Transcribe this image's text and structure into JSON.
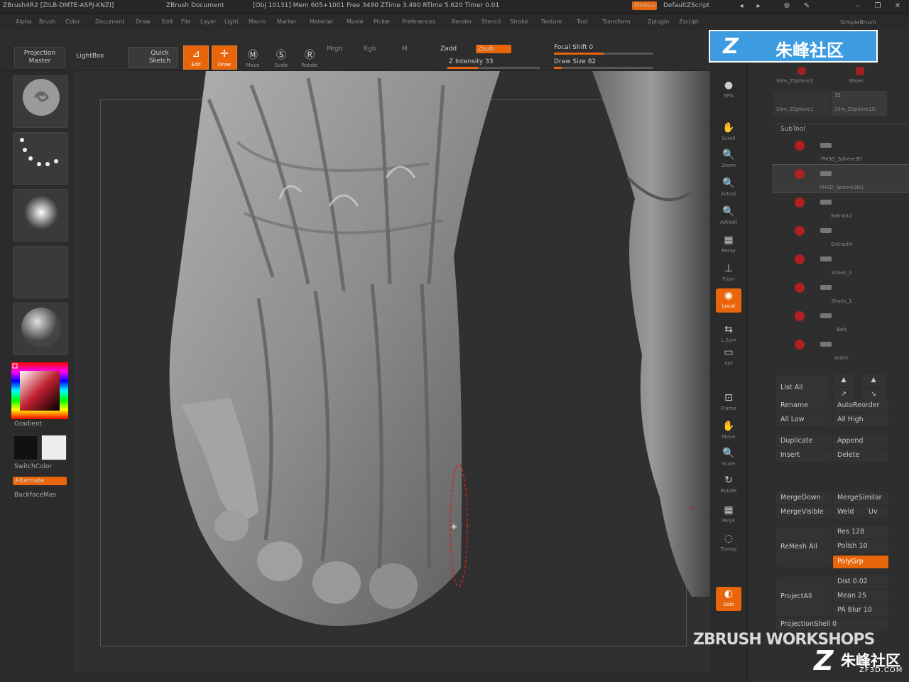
{
  "titlebar": {
    "app": "ZBrush4R2 [ZILB-DMTE-ASPJ-KNZI]",
    "doc": "ZBrush Document",
    "stats": "[Obj 10131]  Mem 605+1001  Free 3490  ZTime 3.490  RTime 5.620  Timer 0.01",
    "menus_label": "Menus",
    "script_label": "DefaultZScript"
  },
  "menubar": {
    "items": [
      "Alpha",
      "Brush",
      "Color",
      "Document",
      "Draw",
      "Edit",
      "File",
      "Layer",
      "Light",
      "Macro",
      "Marker",
      "Material",
      "Movie",
      "Picker",
      "Preferences",
      "Render",
      "Stencil",
      "Stroke",
      "Texture",
      "Tool",
      "Transform",
      "Zplugin",
      "Zscript"
    ]
  },
  "toolbar": {
    "projection_master": "Projection Master",
    "lightbox": "LightBox",
    "quick_sketch": "Quick Sketch",
    "edit": "Edit",
    "draw": "Draw",
    "move": "Move",
    "scale": "Scale",
    "rotate": "Rotate",
    "mrgb": "Mrgb",
    "rgb": "Rgb",
    "m": "M",
    "zadd": "Zadd",
    "zsub": "Zsub",
    "z_intensity_label": "Z Intensity 33",
    "z_intensity": 33,
    "focal_shift_label": "Focal Shift 0",
    "focal_shift": 0,
    "draw_size_label": "Draw Size 82",
    "draw_size": 82
  },
  "left": {
    "gradient_label": "Gradient",
    "switchcolor_label": "SwitchColor",
    "alternate_label": "Alternate",
    "backfacemask_label": "BackfaceMas"
  },
  "shelf": [
    {
      "label": "SPix"
    },
    {
      "label": "Scroll"
    },
    {
      "label": "Zoom"
    },
    {
      "label": "Actual"
    },
    {
      "label": "AAHalf"
    },
    {
      "label": "Persp"
    },
    {
      "label": "Floor"
    },
    {
      "label": "Local"
    },
    {
      "label": "L.Sym"
    },
    {
      "label": "xyz"
    },
    {
      "label": "Frame"
    },
    {
      "label": "Move"
    },
    {
      "label": "Scale"
    },
    {
      "label": "Rotate"
    },
    {
      "label": "PolyF"
    },
    {
      "label": "Transp"
    },
    {
      "label": "Solo"
    }
  ],
  "tray": {
    "simplebrush": "SimpleBrush",
    "tool_thumbs": [
      "Slim_ZSphere2",
      "Shoes",
      "Slim_ZSphere1",
      "Slim_ZSphere1G"
    ],
    "tool_count": "11",
    "subtool_header": "SubTool",
    "subtools": [
      "PM3D_Sphere3D",
      "PM3D_Sphere3D1",
      "Extract2",
      "Extract4",
      "Shoes_2",
      "Shoes_1",
      "Belt",
      "Ankle"
    ],
    "list_all": "List All",
    "rename": "Rename",
    "autoreorder": "AutoReorder",
    "all_low": "All Low",
    "all_high": "All High",
    "duplicate": "Duplicate",
    "append": "Append",
    "insert": "Insert",
    "delete": "Delete",
    "mergedown": "MergeDown",
    "mergesimilar": "MergeSimilar",
    "mergevisible": "MergeVisible",
    "weld": "Weld",
    "uv": "Uv",
    "remesh_all": "ReMesh All",
    "res": "Res 128",
    "polish": "Polish 10",
    "polygrp": "PolyGrp",
    "project_all": "ProjectAll",
    "dist": "Dist 0.02",
    "mean": "Mean 25",
    "pa_blur": "PA Blur 10",
    "projection_shell": "ProjectionShell 0"
  },
  "watermarks": {
    "top_logo": "Z",
    "top_text": "朱峰社区",
    "workshops": "ZBRUSH WORKSHOPS",
    "br_logo": "Z",
    "br_text": "朱峰社区",
    "br_url": "ZF3D.COM"
  }
}
